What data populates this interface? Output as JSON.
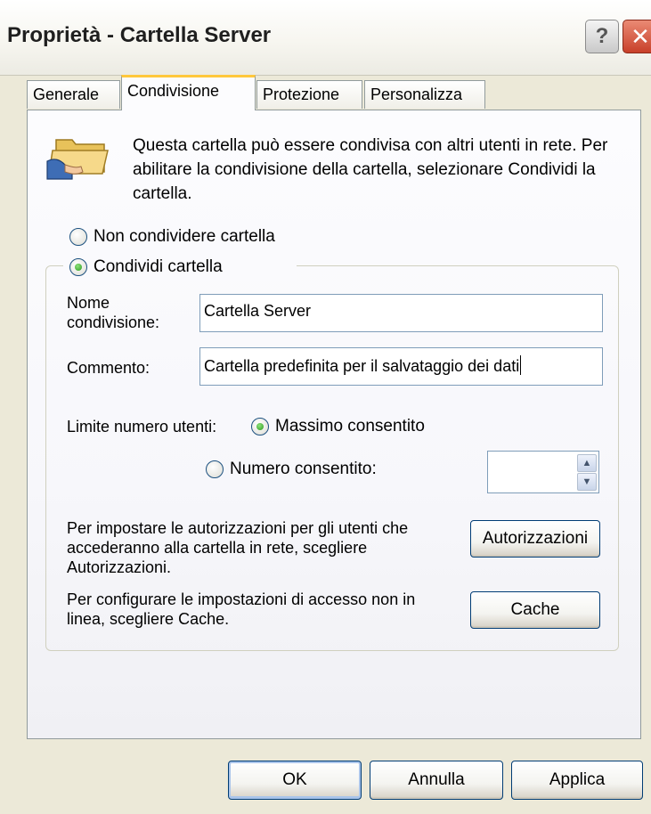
{
  "window": {
    "title": "Proprietà - Cartella Server",
    "help_glyph": "?",
    "close_glyph": "✕"
  },
  "tabs": [
    {
      "label": "Generale",
      "active": false
    },
    {
      "label": "Condivisione",
      "active": true
    },
    {
      "label": "Protezione",
      "active": false
    },
    {
      "label": "Personalizza",
      "active": false
    }
  ],
  "intro_text": "Questa cartella può essere condivisa con altri utenti in rete. Per abilitare la condivisione della cartella, selezionare Condividi la cartella.",
  "sharing": {
    "no_share_label": "Non condividere cartella",
    "share_label": "Condividi cartella",
    "share_selected": true,
    "share_name_label": "Nome condivisione:",
    "share_name_value": "Cartella Server",
    "comment_label": "Commento:",
    "comment_value": "Cartella predefinita per il salvataggio dei dati",
    "user_limit_label": "Limite numero utenti:",
    "max_allowed_label": "Massimo consentito",
    "max_allowed_selected": true,
    "allowed_number_label": "Numero consentito:",
    "allowed_number_value": "",
    "permissions_text": "Per impostare le autorizzazioni per gli utenti che accederanno alla cartella in rete, scegliere Autorizzazioni.",
    "permissions_button": "Autorizzazioni",
    "cache_text": "Per configurare le impostazioni di accesso non in linea, scegliere Cache.",
    "cache_button": "Cache"
  },
  "buttons": {
    "ok": "OK",
    "cancel": "Annulla",
    "apply": "Applica"
  },
  "icons": {
    "folder": "shared-folder-icon",
    "spin_up": "spin-up-arrow-icon",
    "spin_down": "spin-down-arrow-icon"
  },
  "colors": {
    "dialog_bg": "#ece9d8",
    "active_tab_accent": "#ffc83c",
    "radio_checked": "#2b9a1f",
    "close_button": "#c8402a"
  }
}
